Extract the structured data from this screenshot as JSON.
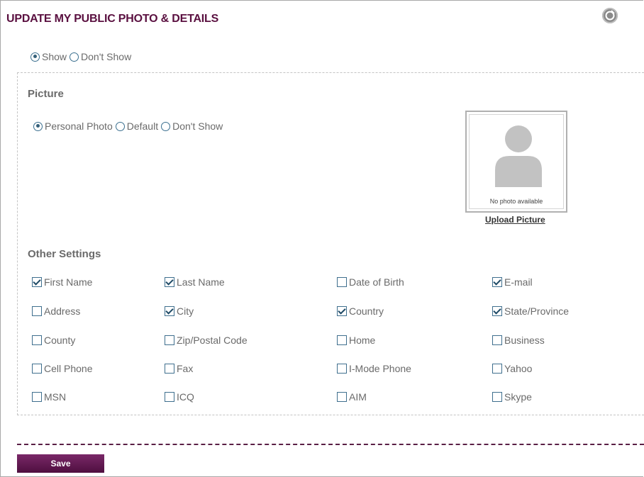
{
  "page": {
    "title": "UPDATE MY PUBLIC PHOTO & DETAILS",
    "help_icon": "help-icon"
  },
  "visibility": {
    "options": [
      {
        "label": "Show",
        "checked": true
      },
      {
        "label": "Don't Show",
        "checked": false
      }
    ]
  },
  "picture": {
    "heading": "Picture",
    "options": [
      {
        "label": "Personal Photo",
        "checked": true
      },
      {
        "label": "Default",
        "checked": false
      },
      {
        "label": "Don't Show",
        "checked": false
      }
    ],
    "no_photo_text": "No photo available",
    "upload_label": "Upload Picture"
  },
  "other_settings": {
    "heading": "Other Settings",
    "rows": [
      [
        {
          "label": "First Name",
          "checked": true
        },
        {
          "label": "Last Name",
          "checked": true
        },
        {
          "label": "Date of Birth",
          "checked": false
        },
        {
          "label": "E-mail",
          "checked": true
        }
      ],
      [
        {
          "label": "Address",
          "checked": false
        },
        {
          "label": "City",
          "checked": true
        },
        {
          "label": "Country",
          "checked": true
        },
        {
          "label": "State/Province",
          "checked": true
        }
      ],
      [
        {
          "label": "County",
          "checked": false
        },
        {
          "label": "Zip/Postal Code",
          "checked": false
        },
        {
          "label": "Home",
          "checked": false
        },
        {
          "label": "Business",
          "checked": false
        }
      ],
      [
        {
          "label": "Cell Phone",
          "checked": false
        },
        {
          "label": "Fax",
          "checked": false
        },
        {
          "label": "I-Mode Phone",
          "checked": false
        },
        {
          "label": "Yahoo",
          "checked": false
        }
      ],
      [
        {
          "label": "MSN",
          "checked": false
        },
        {
          "label": "ICQ",
          "checked": false
        },
        {
          "label": "AIM",
          "checked": false
        },
        {
          "label": "Skype",
          "checked": false
        }
      ]
    ]
  },
  "actions": {
    "save_label": "Save"
  },
  "colors": {
    "title": "#5a1040",
    "save_button": "#6a1f5a",
    "divider": "#5a1f45"
  }
}
